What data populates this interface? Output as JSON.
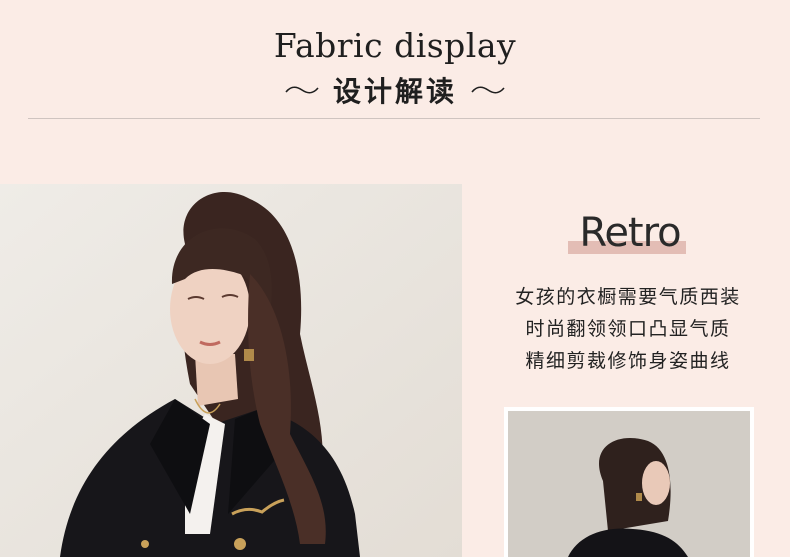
{
  "header": {
    "title_en": "Fabric display",
    "title_cn": "设计解读"
  },
  "feature": {
    "tag": "Retro",
    "lines": [
      "女孩的衣橱需要气质西装",
      "时尚翻领领口凸显气质",
      "精细剪裁修饰身姿曲线"
    ]
  },
  "colors": {
    "background": "#fbece6",
    "accent_bar": "#e3bdb5",
    "text": "#1f1f1f"
  }
}
